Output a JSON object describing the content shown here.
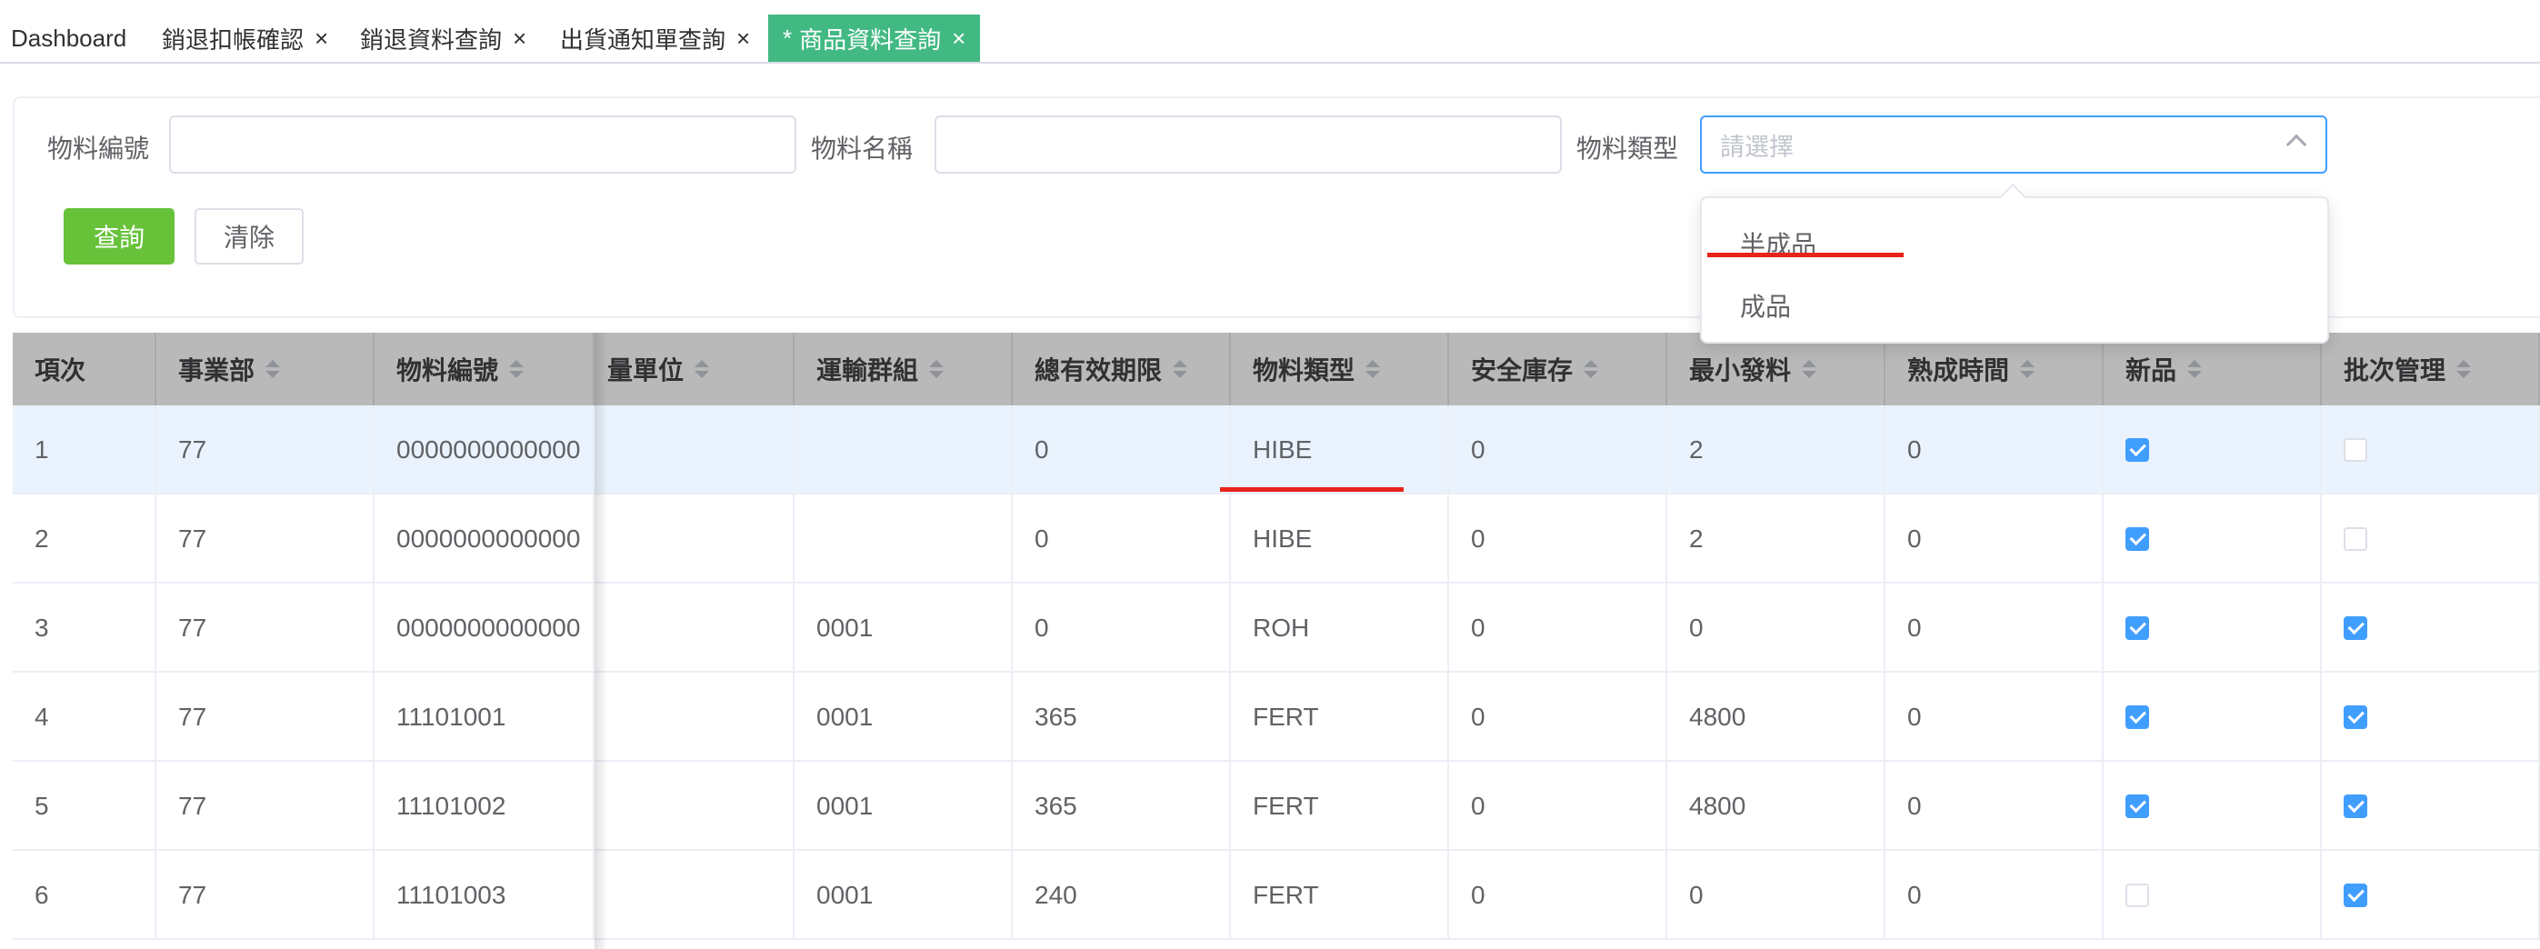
{
  "tabs": [
    {
      "label": "Dashboard",
      "closable": false
    },
    {
      "label": "銷退扣帳確認",
      "closable": true
    },
    {
      "label": "銷退資料查詢",
      "closable": true
    },
    {
      "label": "出貨通知單查詢",
      "closable": true
    },
    {
      "label": "商品資料查詢",
      "closable": true,
      "active": true,
      "modified_marker": "*"
    }
  ],
  "close_glyph": "×",
  "search": {
    "material_no_label": "物料編號",
    "material_name_label": "物料名稱",
    "material_type_label": "物料類型",
    "material_type_placeholder": "請選擇",
    "query_button": "查詢",
    "clear_button": "清除"
  },
  "dropdown": {
    "options": [
      "半成品",
      "成品"
    ]
  },
  "table": {
    "columns": [
      "項次",
      "事業部",
      "物料編號",
      "量單位",
      "運輸群組",
      "總有效期限",
      "物料類型",
      "安全庫存",
      "最小發料",
      "熟成時間",
      "新品",
      "批次管理"
    ],
    "rows": [
      {
        "idx": "1",
        "dept": "77",
        "material_no": "0000000000000",
        "unit": "",
        "transport": "",
        "validity": "0",
        "type": "HIBE",
        "safety": "0",
        "min_issue": "2",
        "aging": "0",
        "new": true,
        "batch": false
      },
      {
        "idx": "2",
        "dept": "77",
        "material_no": "0000000000000",
        "unit": "",
        "transport": "",
        "validity": "0",
        "type": "HIBE",
        "safety": "0",
        "min_issue": "2",
        "aging": "0",
        "new": true,
        "batch": false
      },
      {
        "idx": "3",
        "dept": "77",
        "material_no": "0000000000000",
        "unit": "",
        "transport": "0001",
        "validity": "0",
        "type": "ROH",
        "safety": "0",
        "min_issue": "0",
        "aging": "0",
        "new": true,
        "batch": true
      },
      {
        "idx": "4",
        "dept": "77",
        "material_no": "11101001",
        "unit": "",
        "transport": "0001",
        "validity": "365",
        "type": "FERT",
        "safety": "0",
        "min_issue": "4800",
        "aging": "0",
        "new": true,
        "batch": true
      },
      {
        "idx": "5",
        "dept": "77",
        "material_no": "11101002",
        "unit": "",
        "transport": "0001",
        "validity": "365",
        "type": "FERT",
        "safety": "0",
        "min_issue": "4800",
        "aging": "0",
        "new": true,
        "batch": true
      },
      {
        "idx": "6",
        "dept": "77",
        "material_no": "11101003",
        "unit": "",
        "transport": "0001",
        "validity": "240",
        "type": "FERT",
        "safety": "0",
        "min_issue": "0",
        "aging": "0",
        "new": false,
        "batch": true
      }
    ]
  },
  "colors": {
    "active_tab": "#42b983",
    "query_button": "#67c23a",
    "focus_border": "#409eff",
    "checkbox_checked": "#409eff",
    "annotation_red": "#e8231a",
    "header_bg": "#b9b9b9",
    "highlight_row": "#eaf3fd"
  }
}
